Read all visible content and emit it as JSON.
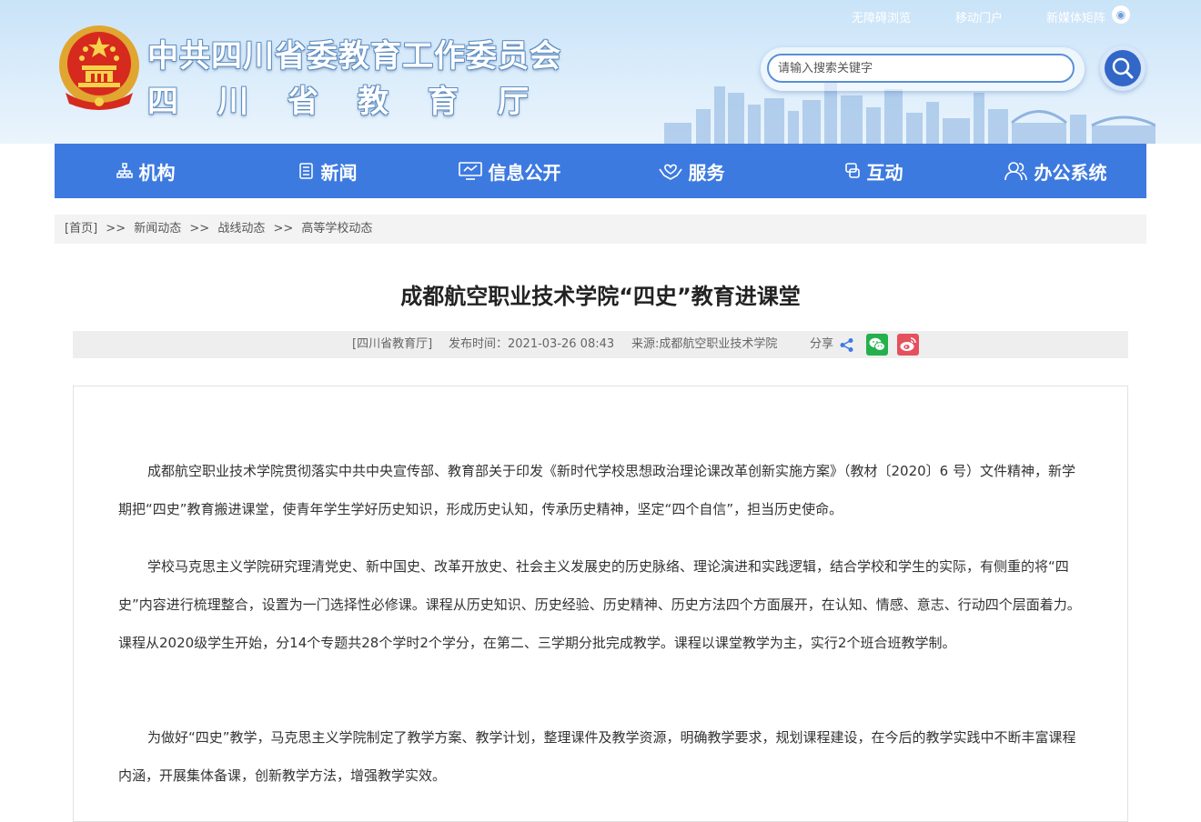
{
  "header": {
    "title_line1": "中共四川省委教育工作委员会",
    "title_line2": "四川省教育厅",
    "top_links": [
      "无障碍浏览",
      "移动门户",
      "新媒体矩阵"
    ],
    "search": {
      "placeholder": "请输入搜索关键字",
      "value": ""
    }
  },
  "nav": {
    "items": [
      {
        "label": "机构",
        "icon": "org-icon"
      },
      {
        "label": "新闻",
        "icon": "news-icon"
      },
      {
        "label": "信息公开",
        "icon": "monitor-icon"
      },
      {
        "label": "服务",
        "icon": "service-hands-icon"
      },
      {
        "label": "互动",
        "icon": "chat-icon"
      },
      {
        "label": "办公系统",
        "icon": "users-icon"
      }
    ]
  },
  "breadcrumb": {
    "items": [
      "[首页]",
      "新闻动态",
      "战线动态",
      "高等学校动态"
    ],
    "separator": ">>"
  },
  "article": {
    "title": "成都航空职业技术学院“四史”教育进课堂",
    "meta": {
      "source_tag": "[四川省教育厅]",
      "published": "发布时间：2021-03-26 08:43",
      "origin": "来源:成都航空职业技术学院",
      "share_label": "分享"
    },
    "paragraphs": [
      "成都航空职业技术学院贯彻落实中共中央宣传部、教育部关于印发《新时代学校思想政治理论课改革创新实施方案》（教材〔2020〕6 号）文件精神，新学期把“四史”教育搬进课堂，使青年学生学好历史知识，形成历史认知，传承历史精神，坚定“四个自信”，担当历史使命。",
      "学校马克思主义学院研究理清党史、新中国史、改革开放史、社会主义发展史的历史脉络、理论演进和实践逻辑，结合学校和学生的实际，有侧重的将“四史”内容进行梳理整合，设置为一门选择性必修课。课程从历史知识、历史经验、历史精神、历史方法四个方面展开，在认知、情感、意志、行动四个层面着力。课程从2020级学生开始，分14个专题共28个学时2个学分，在第二、三学期分批完成教学。课程以课堂教学为主，实行2个班合班教学制。",
      "为做好“四史”教学，马克思主义学院制定了教学方案、教学计划，整理课件及教学资源，明确教学要求，规划课程建设，在今后的教学实践中不断丰富课程内涵，开展集体备课，创新教学方法，增强教学实效。"
    ]
  },
  "colors": {
    "nav_blue": "#3d7ae0",
    "search_blue": "#3267c7",
    "wechat_green": "#22b14c",
    "weibo_red": "#e5505d"
  }
}
